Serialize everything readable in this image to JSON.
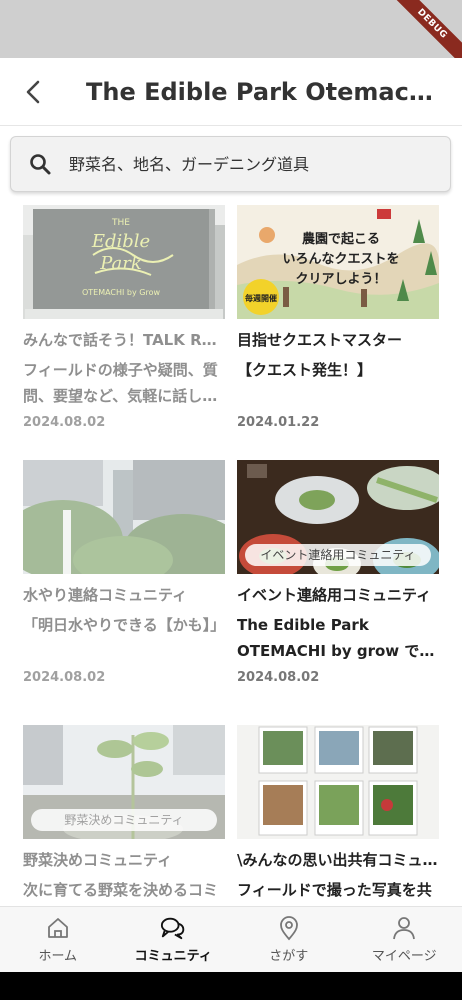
{
  "debug_badge": "DEBUG",
  "header": {
    "title": "The Edible Park Otemachi by grow"
  },
  "search": {
    "placeholder": "野菜名、地名、ガーデニング道具"
  },
  "cards": [
    {
      "name": "みんなで話そう！TALK ROOM",
      "desc": "フィールドの様子や疑問、質問、要望など、気軽に話しましょう",
      "date": "2024.08.02",
      "thumb_label": "",
      "dim": true
    },
    {
      "name": "目指せクエストマスター",
      "desc": "【クエスト発生！】",
      "date": "2024.01.22",
      "thumb_label": "",
      "dim": false
    },
    {
      "name": "水やり連絡コミュニティ",
      "desc": "「明日水やりできる【かも】」",
      "date": "2024.08.02",
      "thumb_label": "",
      "dim": true
    },
    {
      "name": "イベント連絡用コミュニティ",
      "desc": "The Edible Park OTEMACHI by grow でのイベント",
      "date": "2024.08.02",
      "thumb_label": "イベント連絡用コミュニティ",
      "dim": false
    },
    {
      "name": "野菜決めコミュニティ",
      "desc": "次に育てる野菜を決めるコミュニティ",
      "date": "",
      "thumb_label": "野菜決めコミュニティ",
      "dim": true
    },
    {
      "name": "\\みんなの思い出共有コミュニティ",
      "desc": "フィールドで撮った写真を共有しよう",
      "date": "",
      "thumb_label": "",
      "dim": false
    }
  ],
  "quest_banner": {
    "line1": "農園で起こる",
    "line2": "いろんなクエストを",
    "line3": "クリアしよう！",
    "badge": "毎週開催"
  },
  "sign_text": {
    "line1": "THE",
    "line2": "Edible",
    "line3": "Park",
    "line4": "OTEMACHI by Grow"
  },
  "nav": [
    {
      "label": "ホーム",
      "icon": "home-icon",
      "active": false
    },
    {
      "label": "コミュニティ",
      "icon": "community-icon",
      "active": true
    },
    {
      "label": "さがす",
      "icon": "location-pin-icon",
      "active": false
    },
    {
      "label": "マイページ",
      "icon": "person-icon",
      "active": false
    }
  ],
  "colors": {
    "accent_text": "#222222",
    "dim_text": "#8f8f8f",
    "debug_ribbon": "#8a2a1f"
  }
}
